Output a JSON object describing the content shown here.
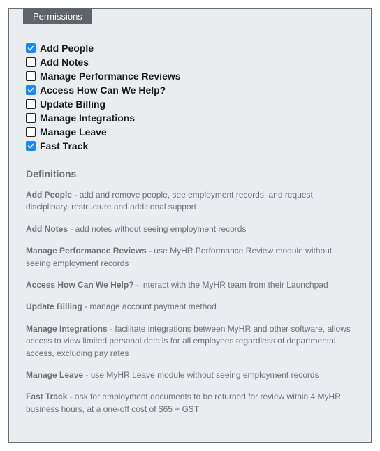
{
  "legend": "Permissions",
  "permissions": [
    {
      "label": "Add People",
      "checked": true
    },
    {
      "label": "Add Notes",
      "checked": false
    },
    {
      "label": "Manage Performance Reviews",
      "checked": false
    },
    {
      "label": "Access How Can We Help?",
      "checked": true
    },
    {
      "label": "Update Billing",
      "checked": false
    },
    {
      "label": "Manage Integrations",
      "checked": false
    },
    {
      "label": "Manage Leave",
      "checked": false
    },
    {
      "label": "Fast Track",
      "checked": true
    }
  ],
  "definitions_heading": "Definitions",
  "definitions": [
    {
      "term": "Add People",
      "desc": "add and remove people, see employment records, and request disciplinary, restructure and additional support"
    },
    {
      "term": "Add Notes",
      "desc": "add notes without seeing employment records"
    },
    {
      "term": "Manage Performance Reviews",
      "desc": "use MyHR Performance Review module without seeing employment records"
    },
    {
      "term": "Access How Can We Help?",
      "desc": "interact with the MyHR team from their Launchpad"
    },
    {
      "term": "Update Billing",
      "desc": "manage account payment method"
    },
    {
      "term": "Manage Integrations",
      "desc": "facilitate integrations between MyHR and other software, allows access to view limited personal details for all employees regardless of departmental access, excluding pay rates"
    },
    {
      "term": "Manage Leave",
      "desc": "use MyHR Leave module without seeing employment records"
    },
    {
      "term": "Fast Track",
      "desc": "ask for employment documents to be returned for review within 4 MyHR business hours, at a one-off cost of $65 + GST"
    }
  ]
}
